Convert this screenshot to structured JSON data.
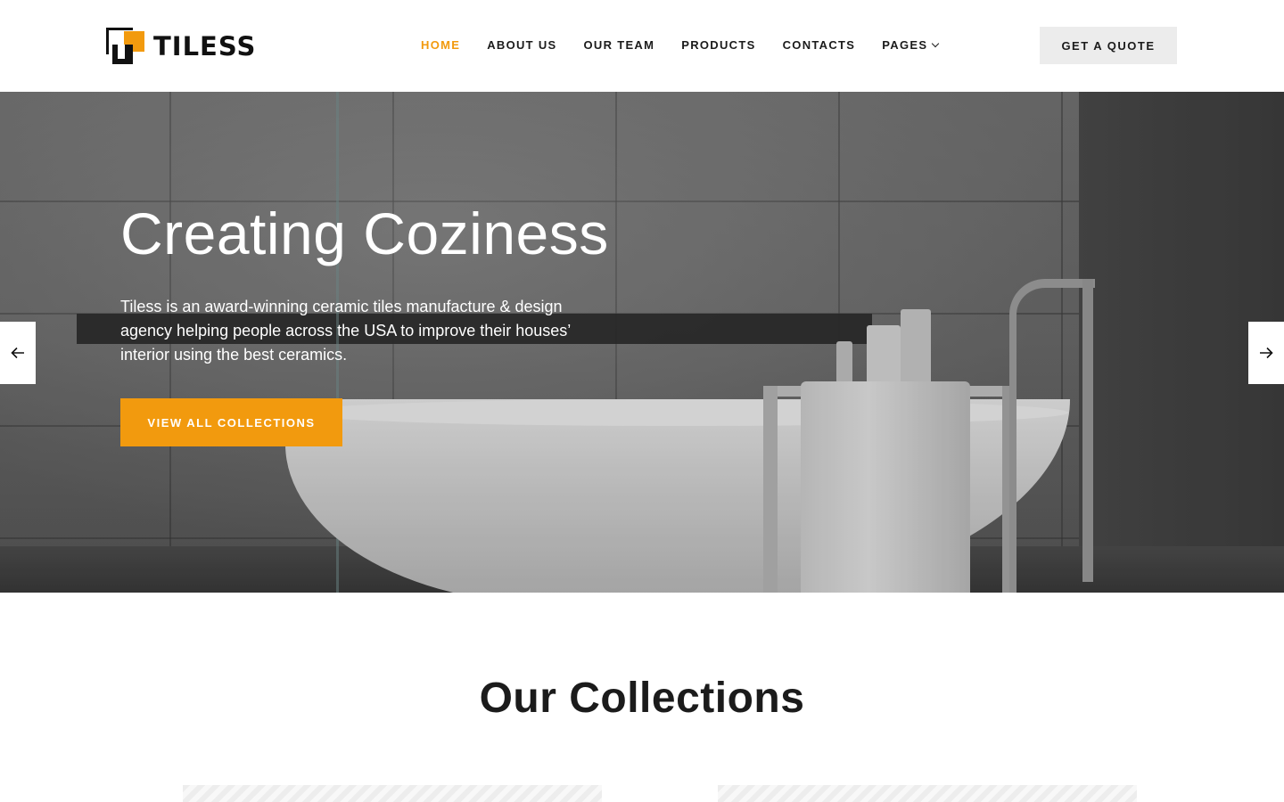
{
  "brand": {
    "name": "TILESS",
    "accent_color": "#f29a0e"
  },
  "nav": {
    "items": [
      {
        "label": "HOME",
        "active": true
      },
      {
        "label": "ABOUT US",
        "active": false
      },
      {
        "label": "OUR TEAM",
        "active": false
      },
      {
        "label": "PRODUCTS",
        "active": false
      },
      {
        "label": "CONTACTS",
        "active": false
      },
      {
        "label": "PAGES",
        "active": false,
        "has_dropdown": true
      }
    ],
    "cta_label": "GET A QUOTE"
  },
  "hero": {
    "title": "Creating Coziness",
    "text": "Tiless is an award-winning ceramic tiles manufacture & design agency helping people across the USA to improve their houses’ interior using the best ceramics.",
    "button_label": "VIEW ALL COLLECTIONS",
    "prev_icon": "arrow-left-icon",
    "next_icon": "arrow-right-icon"
  },
  "collections": {
    "title": "Our Collections"
  }
}
